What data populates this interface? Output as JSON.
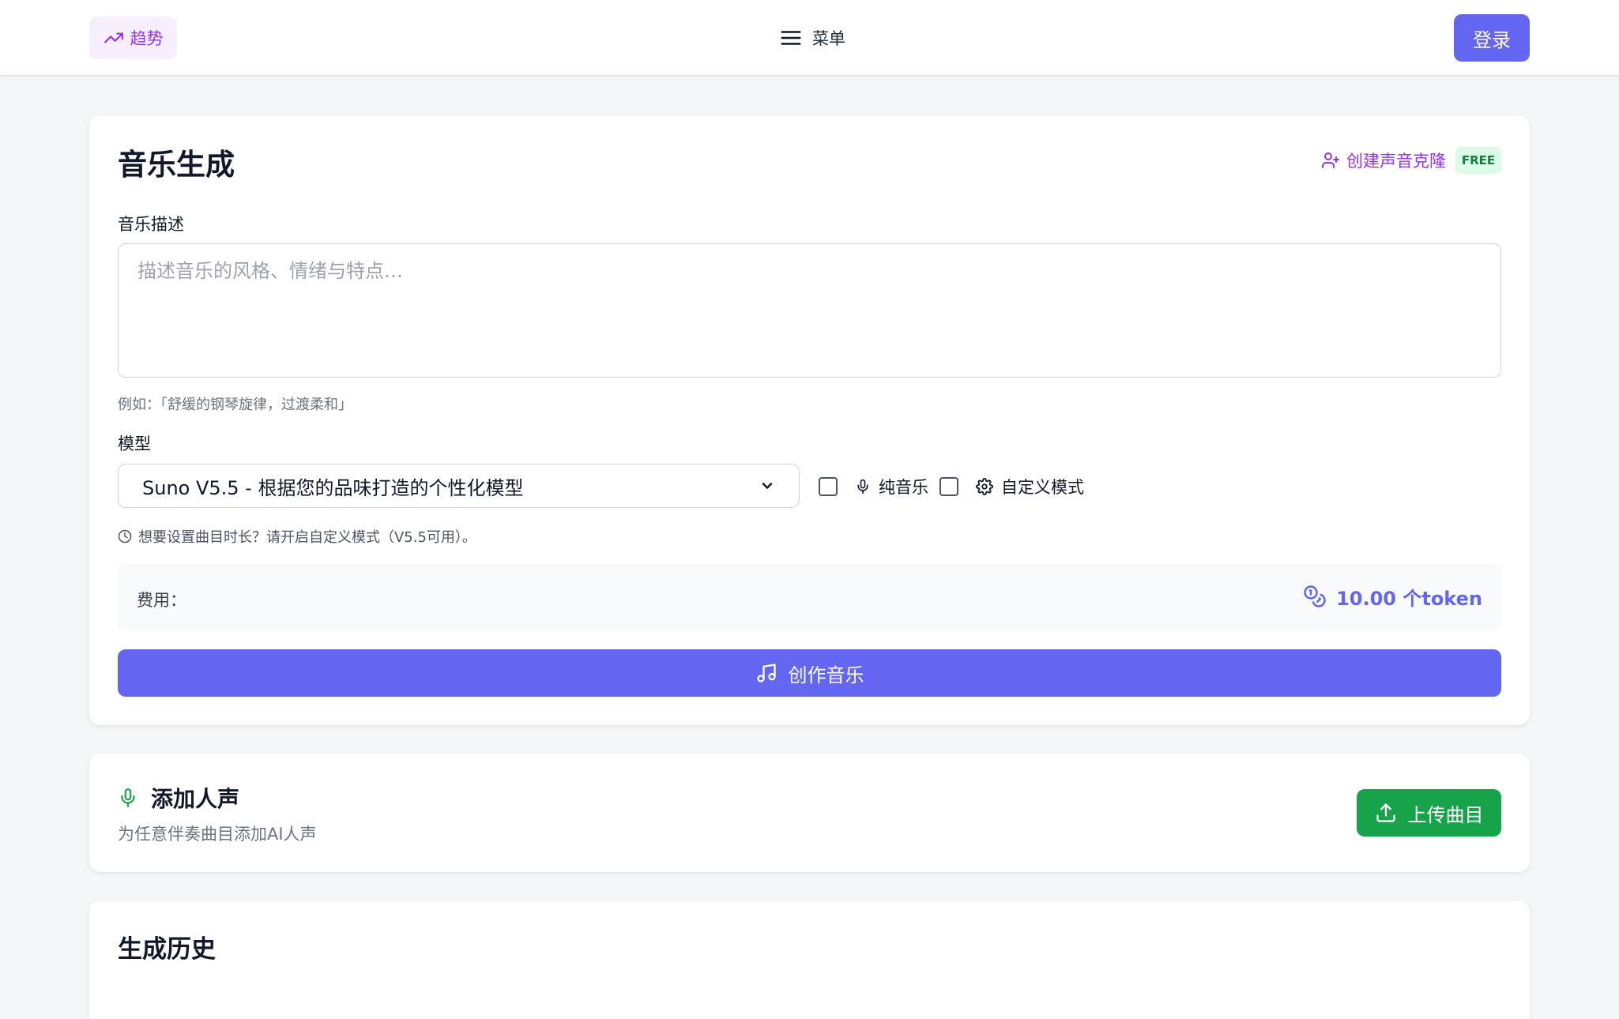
{
  "header": {
    "trend_label": "趋势",
    "menu_label": "菜单",
    "login_label": "登录"
  },
  "generator": {
    "title": "音乐生成",
    "clone_label": "创建声音克隆",
    "free_badge": "FREE",
    "description_label": "音乐描述",
    "description_placeholder": "描述音乐的风格、情绪与特点…",
    "description_value": "",
    "example_hint": "例如：「舒缓的钢琴旋律，过渡柔和」",
    "model_label": "模型",
    "model_selected": "Suno V5.5 - 根据您的品味打造的个性化模型",
    "instrumental_label": "纯音乐",
    "instrumental_checked": false,
    "custom_mode_label": "自定义模式",
    "custom_mode_checked": false,
    "duration_hint": "想要设置曲目时长？请开启自定义模式（V5.5可用）。",
    "cost_label": "费用：",
    "cost_value": "10.00 个token",
    "create_label": "创作音乐"
  },
  "vocal": {
    "title": "添加人声",
    "subtitle": "为任意伴奏曲目添加AI人声",
    "upload_label": "上传曲目"
  },
  "history": {
    "title": "生成历史"
  },
  "colors": {
    "accent": "#6366f1",
    "purple": "#9333ea",
    "green": "#16a34a"
  },
  "icons": {
    "trend": "trending-up-icon",
    "menu": "hamburger-menu-icon",
    "clone": "user-plus-icon",
    "mic": "microphone-icon",
    "gear": "gear-icon",
    "clock": "clock-icon",
    "coins": "coins-icon",
    "music": "music-note-icon",
    "upload": "upload-icon",
    "chevron": "chevron-down-icon"
  }
}
